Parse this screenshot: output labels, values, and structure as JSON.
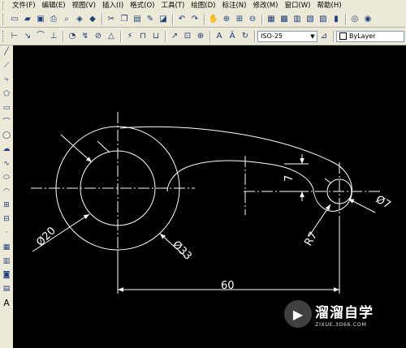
{
  "menubar": {
    "items": [
      "文件(F)",
      "编辑(E)",
      "视图(V)",
      "插入(I)",
      "格式(O)",
      "工具(T)",
      "绘图(D)",
      "标注(N)",
      "修改(M)",
      "窗口(W)",
      "帮助(H)"
    ]
  },
  "toolbar_standard": {
    "icons": [
      "new-icon",
      "open-icon",
      "save-icon",
      "print-icon",
      "plot-preview-icon",
      "publish-icon",
      "3d-dwf-icon",
      "cut-icon",
      "copy-icon",
      "paste-icon",
      "match-properties-icon",
      "block-editor-icon",
      "undo-icon",
      "redo-icon",
      "pan-icon",
      "zoom-realtime-icon",
      "zoom-window-icon",
      "zoom-previous-icon",
      "properties-icon",
      "design-center-icon",
      "tool-palettes-icon",
      "sheet-set-icon",
      "markup-icon",
      "calculator-icon"
    ]
  },
  "toolbar_dimension": {
    "icons": [
      "linear-dim-icon",
      "aligned-dim-icon",
      "arc-length-icon",
      "ordinate-icon",
      "radius-dim-icon",
      "jogged-icon",
      "diameter-dim-icon",
      "angular-dim-icon",
      "quick-dim-icon",
      "baseline-icon",
      "continue-icon",
      "quick-leader-icon",
      "tolerance-icon",
      "center-mark-icon",
      "dim-edit-icon",
      "dim-text-edit-icon",
      "dim-update-icon"
    ],
    "dimstyle_value": "ISO-25",
    "layer_value": "ByLayer"
  },
  "draw_toolbar": {
    "icons": [
      "line-icon",
      "construction-line-icon",
      "polyline-icon",
      "polygon-icon",
      "rectangle-icon",
      "arc-icon",
      "circle-icon",
      "revision-cloud-icon",
      "spline-icon",
      "ellipse-icon",
      "ellipse-arc-icon",
      "insert-block-icon",
      "make-block-icon",
      "point-icon",
      "hatch-icon",
      "gradient-icon",
      "region-icon",
      "table-icon",
      "multiline-text-icon"
    ],
    "text_tool_label": "A"
  },
  "drawing": {
    "dimensions": {
      "large_diameter_label": "Ø20",
      "outer_diameter_label": "Ø33",
      "horizontal_distance_label": "60",
      "small_radius_label": "R7",
      "small_diameter_label": "Ø7",
      "vertical_offset_label": "7"
    }
  },
  "watermark": {
    "title": "溜溜自学",
    "url": "ZIXUE.3D66.COM"
  },
  "colors": {
    "canvas_bg": "#000000",
    "geometry": "#ffffff",
    "ui_bg": "#ece9d8"
  }
}
